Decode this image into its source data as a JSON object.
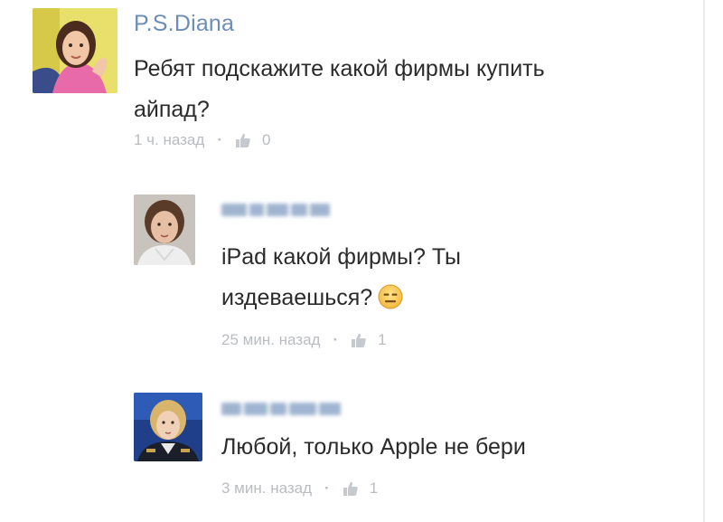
{
  "comments": [
    {
      "author": "P.S.Diana",
      "line1": "Ребят подскажите какой фирмы купить",
      "line2": "айпад?",
      "time": "1 ч. назад",
      "separator": "·",
      "likes": "0"
    },
    {
      "author": "",
      "line1": "iPad какой фирмы? Ты",
      "line2": "издеваешься?",
      "time": "25 мин. назад",
      "separator": "·",
      "likes": "1",
      "emoji_icon": "expressionless-face-icon"
    },
    {
      "author": "",
      "line1": "Любой, только Apple не бери",
      "time": "3 мин. назад",
      "separator": "·",
      "likes": "1"
    }
  ],
  "colors": {
    "author": "#6d8eb4",
    "text": "#2b2b2b",
    "meta": "#b9bcc0",
    "background": "#ffffff"
  }
}
